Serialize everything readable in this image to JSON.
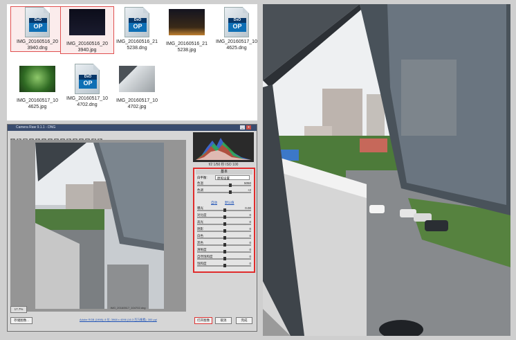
{
  "files": [
    {
      "name_line1": "IMG_20160516_20",
      "name_line2": "3940.dng",
      "icon": "dxo-optics-icon",
      "selected": true
    },
    {
      "name_line1": "IMG_20160516_20",
      "name_line2": "3940.jpg",
      "icon": "night-photo-thumbnail",
      "selected": true
    },
    {
      "name_line1": "IMG_20160516_21",
      "name_line2": "5238.dng",
      "icon": "dxo-optics-icon",
      "selected": false
    },
    {
      "name_line1": "IMG_20160516_21",
      "name_line2": "5238.jpg",
      "icon": "night-street-thumbnail",
      "selected": false
    },
    {
      "name_line1": "IMG_20160517_10",
      "name_line2": "4625.dng",
      "icon": "dxo-optics-icon",
      "selected": false
    },
    {
      "name_line1": "IMG_20160517_10",
      "name_line2": "4625.jpg",
      "icon": "plant-photo-thumbnail",
      "selected": false
    },
    {
      "name_line1": "IMG_20160517_10",
      "name_line2": "4702.dng",
      "icon": "dxo-optics-icon",
      "selected": false
    },
    {
      "name_line1": "IMG_20160517_10",
      "name_line2": "4702.jpg",
      "icon": "building-photo-thumbnail",
      "selected": false
    }
  ],
  "dxo_badge": {
    "top": "DxO",
    "main": "OP"
  },
  "dialog": {
    "title": "Camera Raw 9.1.1 - DNG",
    "filename": "IMG_20160517_104702.dng",
    "zoom": "17.7%",
    "info": "Adobe RGB (1998); 8 位; 3968 x 4096 (16.3 百万像素); 300 ppi",
    "buttons": {
      "save": "存储图像...",
      "open": "打开图像",
      "cancel": "取消",
      "done": "完成"
    },
    "panel_title": "基本",
    "white_balance_label": "白平衡:",
    "white_balance_value": "原照设置",
    "auto_link": "自动",
    "default_link": "默认值",
    "rows": [
      {
        "label": "色温",
        "value": "5050"
      },
      {
        "label": "色调",
        "value": "+2"
      },
      {
        "label": "曝光",
        "value": "0.00"
      },
      {
        "label": "对比度",
        "value": "0"
      },
      {
        "label": "高光",
        "value": "0"
      },
      {
        "label": "阴影",
        "value": "0"
      },
      {
        "label": "白色",
        "value": "0"
      },
      {
        "label": "黑色",
        "value": "0"
      },
      {
        "label": "清晰度",
        "value": "0"
      },
      {
        "label": "自然饱和度",
        "value": "0"
      },
      {
        "label": "饱和度",
        "value": "0"
      }
    ],
    "readout": "f/2   1/50 秒   ISO 100"
  },
  "colors": {
    "selection": "#e05050",
    "panel_border": "#e02b2b",
    "dxo_blue": "#0e6fb5"
  }
}
